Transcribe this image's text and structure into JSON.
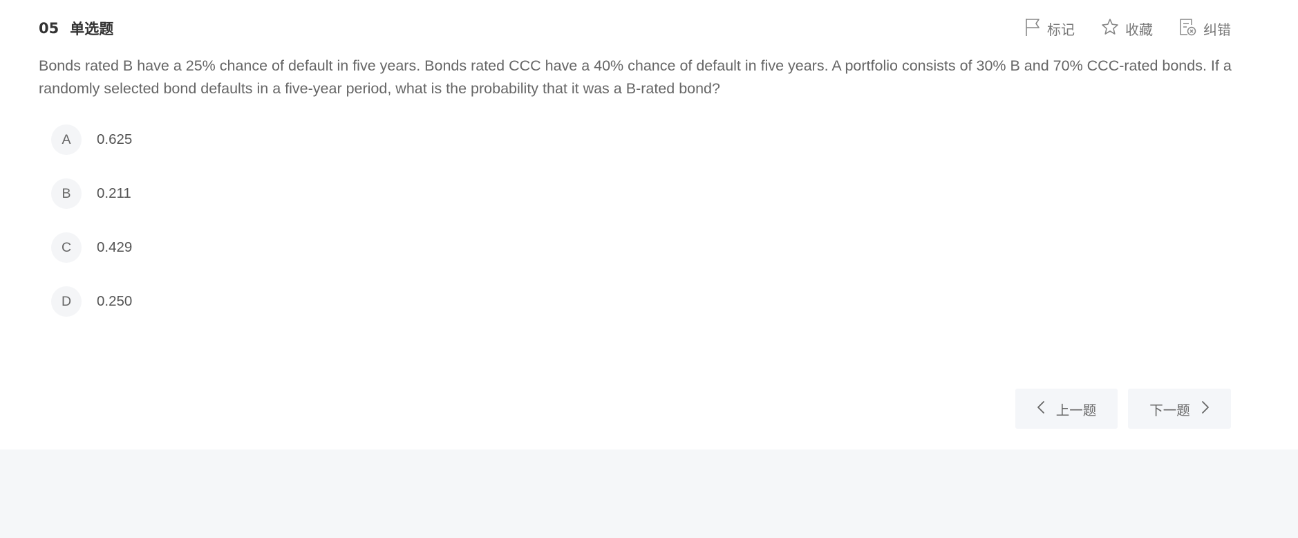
{
  "question": {
    "number": "05",
    "type": "单选题",
    "text": "Bonds rated B have a 25% chance of default in five years. Bonds rated CCC have a 40% chance of default in five years. A portfolio consists of 30% B and 70% CCC-rated bonds. If a randomly selected bond defaults in a five-year period, what is the probability that it was a B-rated bond?"
  },
  "actions": {
    "mark_label": "标记",
    "favorite_label": "收藏",
    "report_label": "纠错"
  },
  "options": [
    {
      "letter": "A",
      "text": "0.625"
    },
    {
      "letter": "B",
      "text": "0.211"
    },
    {
      "letter": "C",
      "text": "0.429"
    },
    {
      "letter": "D",
      "text": "0.250"
    }
  ],
  "nav": {
    "prev_label": "上一题",
    "next_label": "下一题"
  },
  "icons": {
    "mark": "flag-icon",
    "favorite": "star-icon",
    "report": "report-error-icon",
    "prev": "chevron-left-icon",
    "next": "chevron-right-icon"
  },
  "colors": {
    "page_bg": "#f5f7f9",
    "panel_bg": "#ffffff",
    "option_badge_bg": "#f4f5f7",
    "nav_button_bg": "#f4f6f9",
    "title_text": "#333333",
    "body_text": "#666666"
  }
}
